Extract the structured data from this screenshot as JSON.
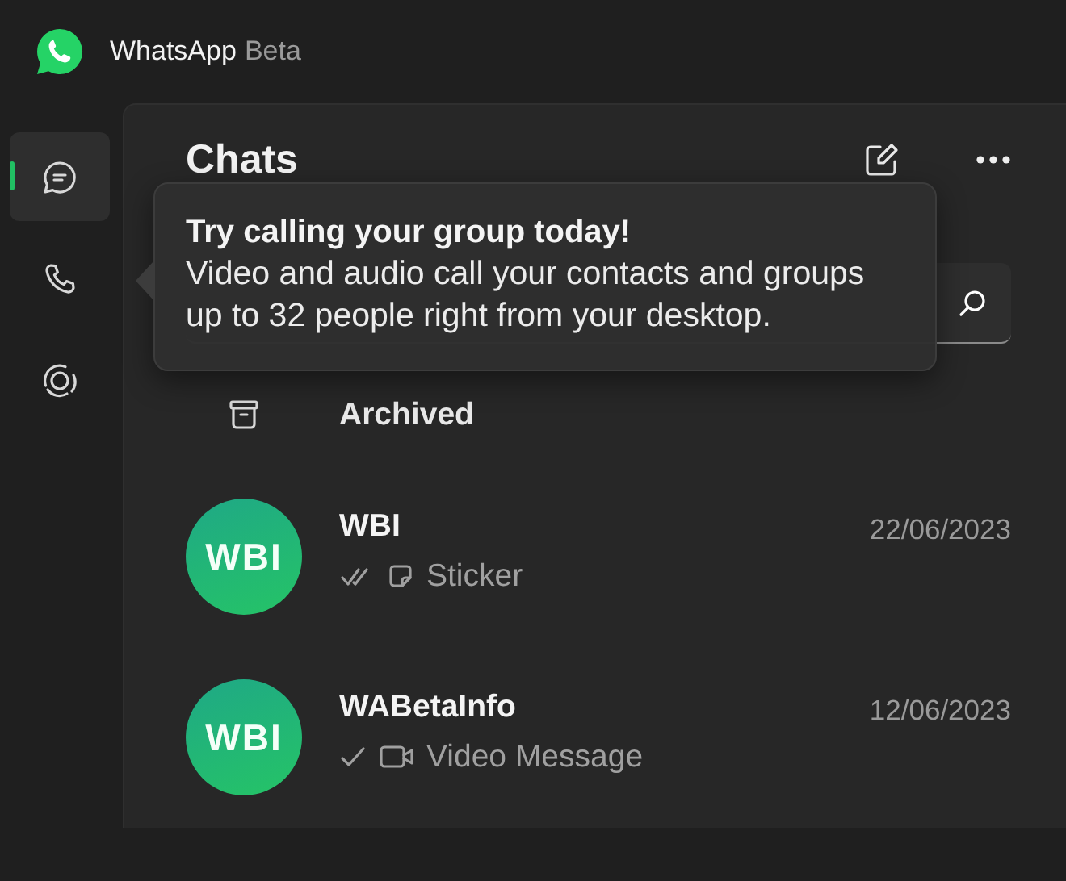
{
  "title_bar": {
    "app_name": "WhatsApp",
    "badge": "Beta"
  },
  "nav": [
    {
      "kind": "chats",
      "selected": true
    },
    {
      "kind": "calls",
      "selected": false
    },
    {
      "kind": "status",
      "selected": false
    }
  ],
  "chats_panel": {
    "title": "Chats",
    "archived": {
      "label": "Archived"
    },
    "chats": [
      {
        "avatar_text": "WBI",
        "name": "WBI",
        "date": "22/06/2023",
        "delivered": true,
        "kind": "sticker",
        "preview": "Sticker"
      },
      {
        "avatar_text": "WBI",
        "name": "WABetaInfo",
        "date": "12/06/2023",
        "delivered": false,
        "kind": "video",
        "preview": "Video Message"
      }
    ]
  },
  "tooltip": {
    "title": "Try calling your group today!",
    "body": "Video and audio call your contacts and groups up to 32 people right from your desktop."
  }
}
